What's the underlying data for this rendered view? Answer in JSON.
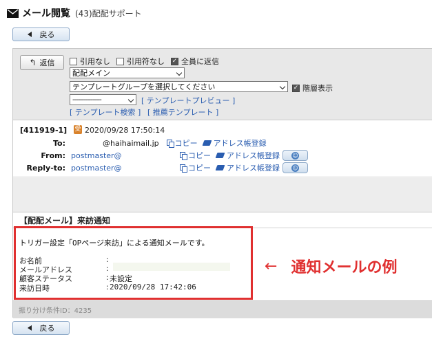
{
  "header": {
    "title": "メール閲覧",
    "subtitle": "(43)配配サポート"
  },
  "back_label": "戻る",
  "toolbar": {
    "reply_label": "返信",
    "checkboxes": [
      {
        "label": "引用なし",
        "checked": false
      },
      {
        "label": "引用符なし",
        "checked": false
      },
      {
        "label": "全員に返信",
        "checked": true
      }
    ],
    "mode_select": "配配メイン",
    "group_select": "テンプレートグループを選択してください",
    "hierarchy_label": "階層表示",
    "hierarchy_checked": true,
    "template_select": "----------------",
    "link_preview": "[ テンプレートプレビュー ]",
    "link_search": "[ テンプレート検索 ]",
    "link_recommend": "[ 推薦テンプレート ]"
  },
  "message": {
    "id": "[411919-1]",
    "received_icon": "受",
    "date": "2020/09/28 17:50:14",
    "to_label": "To:",
    "to_address": "@haihaimail.jp",
    "from_label": "From:",
    "from_address": "postmaster@",
    "replyto_label": "Reply-to:",
    "replyto_address": "postmaster@",
    "copy_label": "コピー",
    "addressbook_label": "アドレス帳登録"
  },
  "subject": "【配配メール】来訪通知",
  "body": {
    "intro": "トリガー設定「OPページ来訪」による通知メールです。",
    "fields": [
      {
        "name": "お名前",
        "value": ""
      },
      {
        "name": "メールアドレス",
        "value": ""
      },
      {
        "name": "顧客ステータス",
        "value": "未設定"
      },
      {
        "name": "来訪日時",
        "value": "2020/09/28 17:42:06"
      }
    ],
    "colon": ":"
  },
  "annotation": {
    "arrow": "←",
    "text": "通知メールの例"
  },
  "footer": "振り分け条件ID：4235",
  "colors": {
    "accent_red": "#e03030",
    "link_blue": "#2a5db0"
  }
}
